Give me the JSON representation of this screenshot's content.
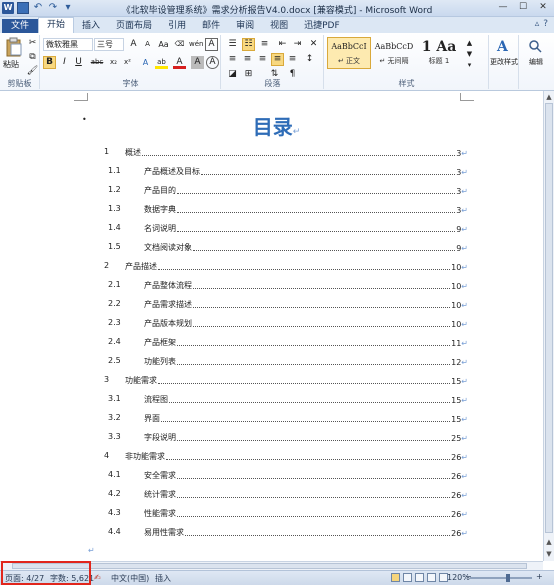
{
  "window": {
    "title": "《北软毕设管理系统》需求分析报告V4.0.docx [兼容模式] - Microsoft Word",
    "controls": [
      "—",
      "☐",
      "✕"
    ]
  },
  "quick_access": {
    "app_icon": "W",
    "undo": "↶",
    "redo": "↷",
    "customize": "▾"
  },
  "tabs": [
    {
      "label": "文件"
    },
    {
      "label": "开始"
    },
    {
      "label": "插入"
    },
    {
      "label": "页面布局"
    },
    {
      "label": "引用"
    },
    {
      "label": "邮件"
    },
    {
      "label": "审阅"
    },
    {
      "label": "视图"
    },
    {
      "label": "迅捷PDF"
    }
  ],
  "ribbon": {
    "clipboard": {
      "paste_label": "粘贴",
      "group_label": "剪贴板"
    },
    "font": {
      "font_name": "微软雅黑",
      "font_size": "三号",
      "grow": "A",
      "shrink": "A",
      "clear": "Aa",
      "phonetic": "wén",
      "border_char": "A",
      "bold": "B",
      "italic": "I",
      "underline": "U",
      "strike": "abc",
      "subscript": "x₂",
      "superscript": "x²",
      "highlight": "ab",
      "font_color": "A",
      "shade": "A",
      "enclose": "A",
      "group_label": "字体"
    },
    "paragraph": {
      "group_label": "段落"
    },
    "styles": {
      "items": [
        {
          "sample": "AaBbCcI",
          "name": "↵ 正文"
        },
        {
          "sample": "AaBbCcD",
          "name": "↵ 无间隔"
        },
        {
          "sample": "1 Aa",
          "name": "标题 1"
        }
      ],
      "change_styles": "更改样式",
      "group_label": "样式"
    },
    "editing": {
      "label": "编辑"
    }
  },
  "document": {
    "toc_title": "目录",
    "para_mark": "↵",
    "bullet": "•",
    "entries": [
      {
        "num": "1",
        "text": "概述",
        "page": "3",
        "level": 1
      },
      {
        "num": "1.1",
        "text": "产品概述及目标",
        "page": "3",
        "level": 2
      },
      {
        "num": "1.2",
        "text": "产品目的",
        "page": "3",
        "level": 2
      },
      {
        "num": "1.3",
        "text": "数据字典",
        "page": "3",
        "level": 2
      },
      {
        "num": "1.4",
        "text": "名词说明",
        "page": "9",
        "level": 2
      },
      {
        "num": "1.5",
        "text": "文档阅读对象",
        "page": "9",
        "level": 2
      },
      {
        "num": "2",
        "text": "产品描述",
        "page": "10",
        "level": 1
      },
      {
        "num": "2.1",
        "text": "产品整体流程",
        "page": "10",
        "level": 2
      },
      {
        "num": "2.2",
        "text": "产品需求描述",
        "page": "10",
        "level": 2
      },
      {
        "num": "2.3",
        "text": "产品版本规划",
        "page": "10",
        "level": 2
      },
      {
        "num": "2.4",
        "text": "产品框架",
        "page": "11",
        "level": 2
      },
      {
        "num": "2.5",
        "text": "功能列表",
        "page": "12",
        "level": 2
      },
      {
        "num": "3",
        "text": "功能需求",
        "page": "15",
        "level": 1
      },
      {
        "num": "3.1",
        "text": "流程图",
        "page": "15",
        "level": 2
      },
      {
        "num": "3.2",
        "text": "界面",
        "page": "15",
        "level": 2
      },
      {
        "num": "3.3",
        "text": "字段说明",
        "page": "25",
        "level": 2
      },
      {
        "num": "4",
        "text": "非功能需求",
        "page": "26",
        "level": 1
      },
      {
        "num": "4.1",
        "text": "安全需求",
        "page": "26",
        "level": 2
      },
      {
        "num": "4.2",
        "text": "统计需求",
        "page": "26",
        "level": 2
      },
      {
        "num": "4.3",
        "text": "性能需求",
        "page": "26",
        "level": 2
      },
      {
        "num": "4.4",
        "text": "易用性需求",
        "page": "26",
        "level": 2
      }
    ]
  },
  "statusbar": {
    "page": "页面: 4/27",
    "words": "字数: 5,621",
    "language": "中文(中国)",
    "mode": "插入",
    "zoom": "120%",
    "zoom_out": "−",
    "zoom_in": "+"
  }
}
